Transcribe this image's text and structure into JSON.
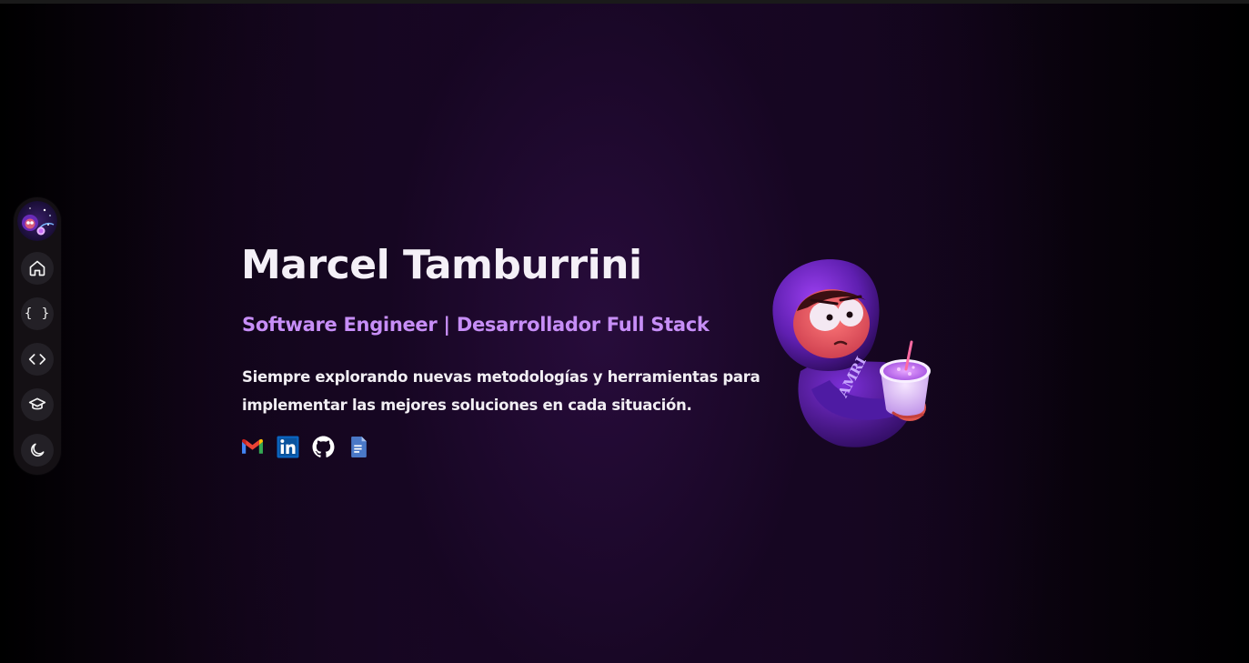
{
  "hero": {
    "name": "Marcel Tamburrini",
    "subtitle": "Software Engineer | Desarrollador Full Stack",
    "description": "Siempre explorando nuevas metodologías y herramientas para implementar las mejores soluciones en cada situación."
  },
  "sidebar": {
    "items": [
      {
        "icon": "home-icon"
      },
      {
        "icon": "braces-icon",
        "glyph": "{ }"
      },
      {
        "icon": "code-icon"
      },
      {
        "icon": "graduation-cap-icon"
      },
      {
        "icon": "moon-icon"
      }
    ]
  },
  "social": [
    {
      "icon": "gmail-icon"
    },
    {
      "icon": "linkedin-icon"
    },
    {
      "icon": "github-icon"
    },
    {
      "icon": "document-icon"
    }
  ],
  "character": {
    "hoodie_text": "AMRI"
  },
  "colors": {
    "accent": "#c78ef7",
    "text": "#f4f0f7",
    "sidebar_bg": "#141014",
    "button_bg": "#232026"
  }
}
